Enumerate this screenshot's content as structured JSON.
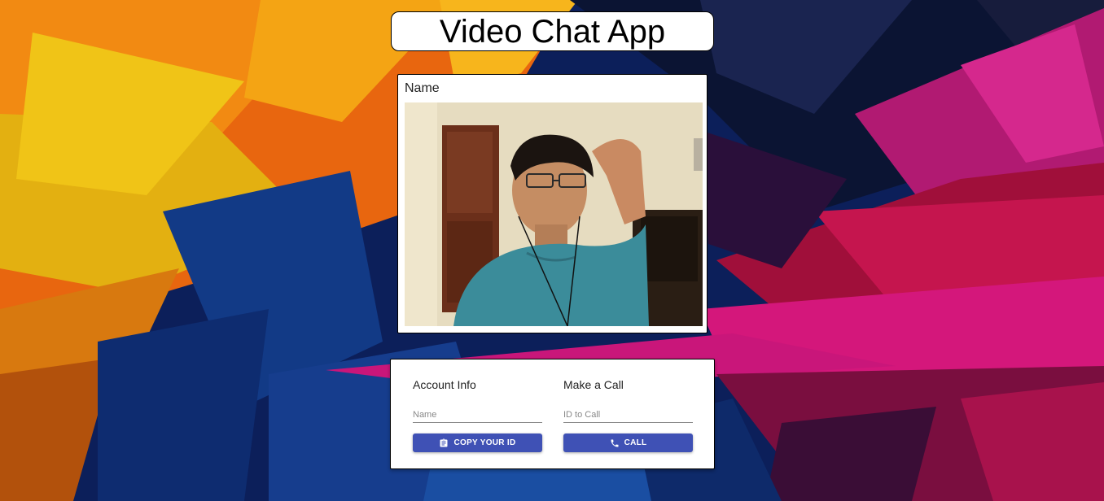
{
  "header": {
    "title": "Video Chat App"
  },
  "video": {
    "name_label": "Name"
  },
  "options": {
    "account": {
      "heading": "Account Info",
      "name_placeholder": "Name",
      "name_value": "",
      "copy_button_label": "COPY YOUR ID",
      "copy_icon": "clipboard-icon"
    },
    "call": {
      "heading": "Make a Call",
      "id_placeholder": "ID to Call",
      "id_value": "",
      "call_button_label": "CALL",
      "call_icon": "phone-icon"
    }
  },
  "colors": {
    "primary": "#3f51b5"
  }
}
